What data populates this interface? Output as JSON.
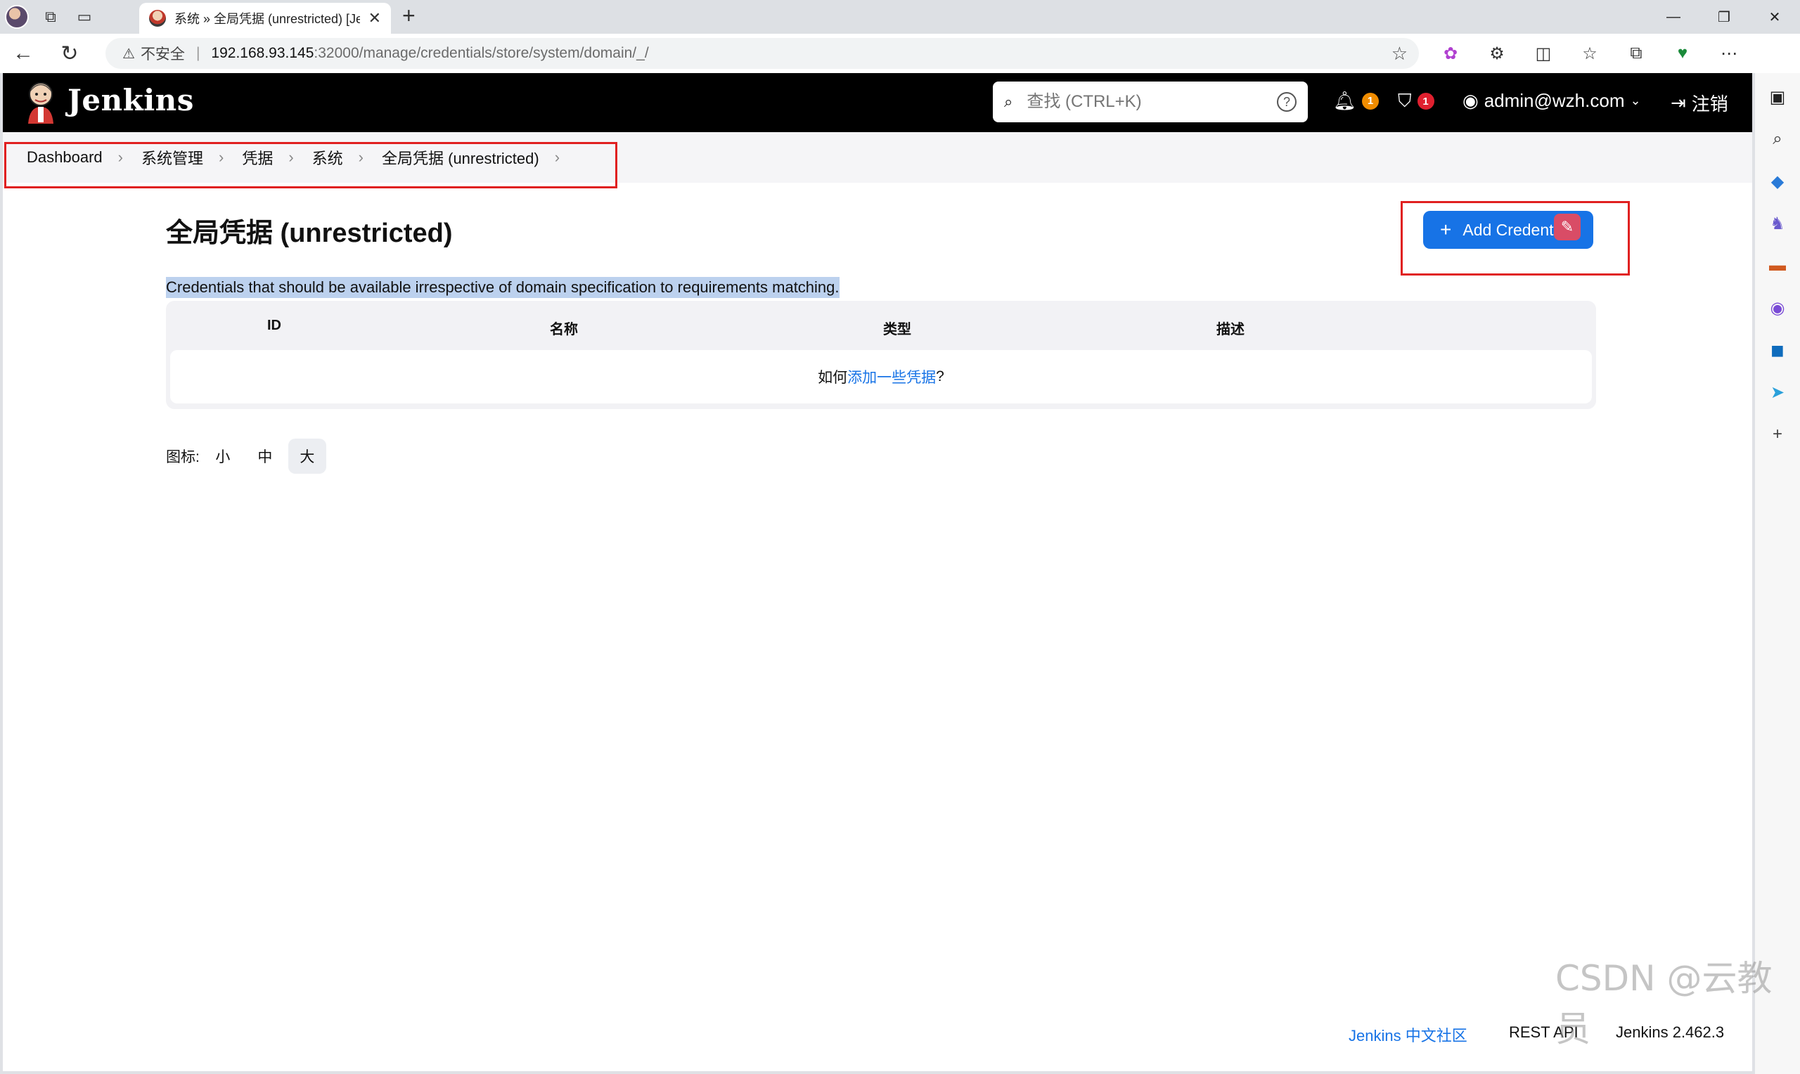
{
  "browser": {
    "tab_title": "系统 » 全局凭据 (unrestricted) [Je",
    "url_warning": "不安全",
    "url_host": "192.168.93.145",
    "url_path": ":32000/manage/credentials/store/system/domain/_/"
  },
  "jenkins": {
    "brand": "Jenkins",
    "search_placeholder": "查找 (CTRL+K)",
    "notifications_count": "1",
    "security_count": "1",
    "user": "admin@wzh.com",
    "logout": "注销"
  },
  "breadcrumbs": [
    "Dashboard",
    "系统管理",
    "凭据",
    "系统",
    "全局凭据 (unrestricted)"
  ],
  "main": {
    "title": "全局凭据 (unrestricted)",
    "description": "Credentials that should be available irrespective of domain specification to requirements matching.",
    "add_button": "Add Credent",
    "table": {
      "columns": [
        "ID",
        "名称",
        "类型",
        "描述"
      ],
      "empty_prefix": "如何",
      "empty_link": "添加一些凭据",
      "empty_suffix": "?"
    },
    "icon_size": {
      "label": "图标:",
      "options": [
        "小",
        "中",
        "大"
      ],
      "selected": "大"
    }
  },
  "footer": {
    "community": "Jenkins 中文社区",
    "rest_api": "REST API",
    "version": "Jenkins 2.462.3"
  },
  "watermark": "CSDN @云教员",
  "colors": {
    "accent": "#1773e6",
    "highlight_box": "#e02020",
    "notification_badge": "#f08c00",
    "security_badge": "#e0202f"
  }
}
